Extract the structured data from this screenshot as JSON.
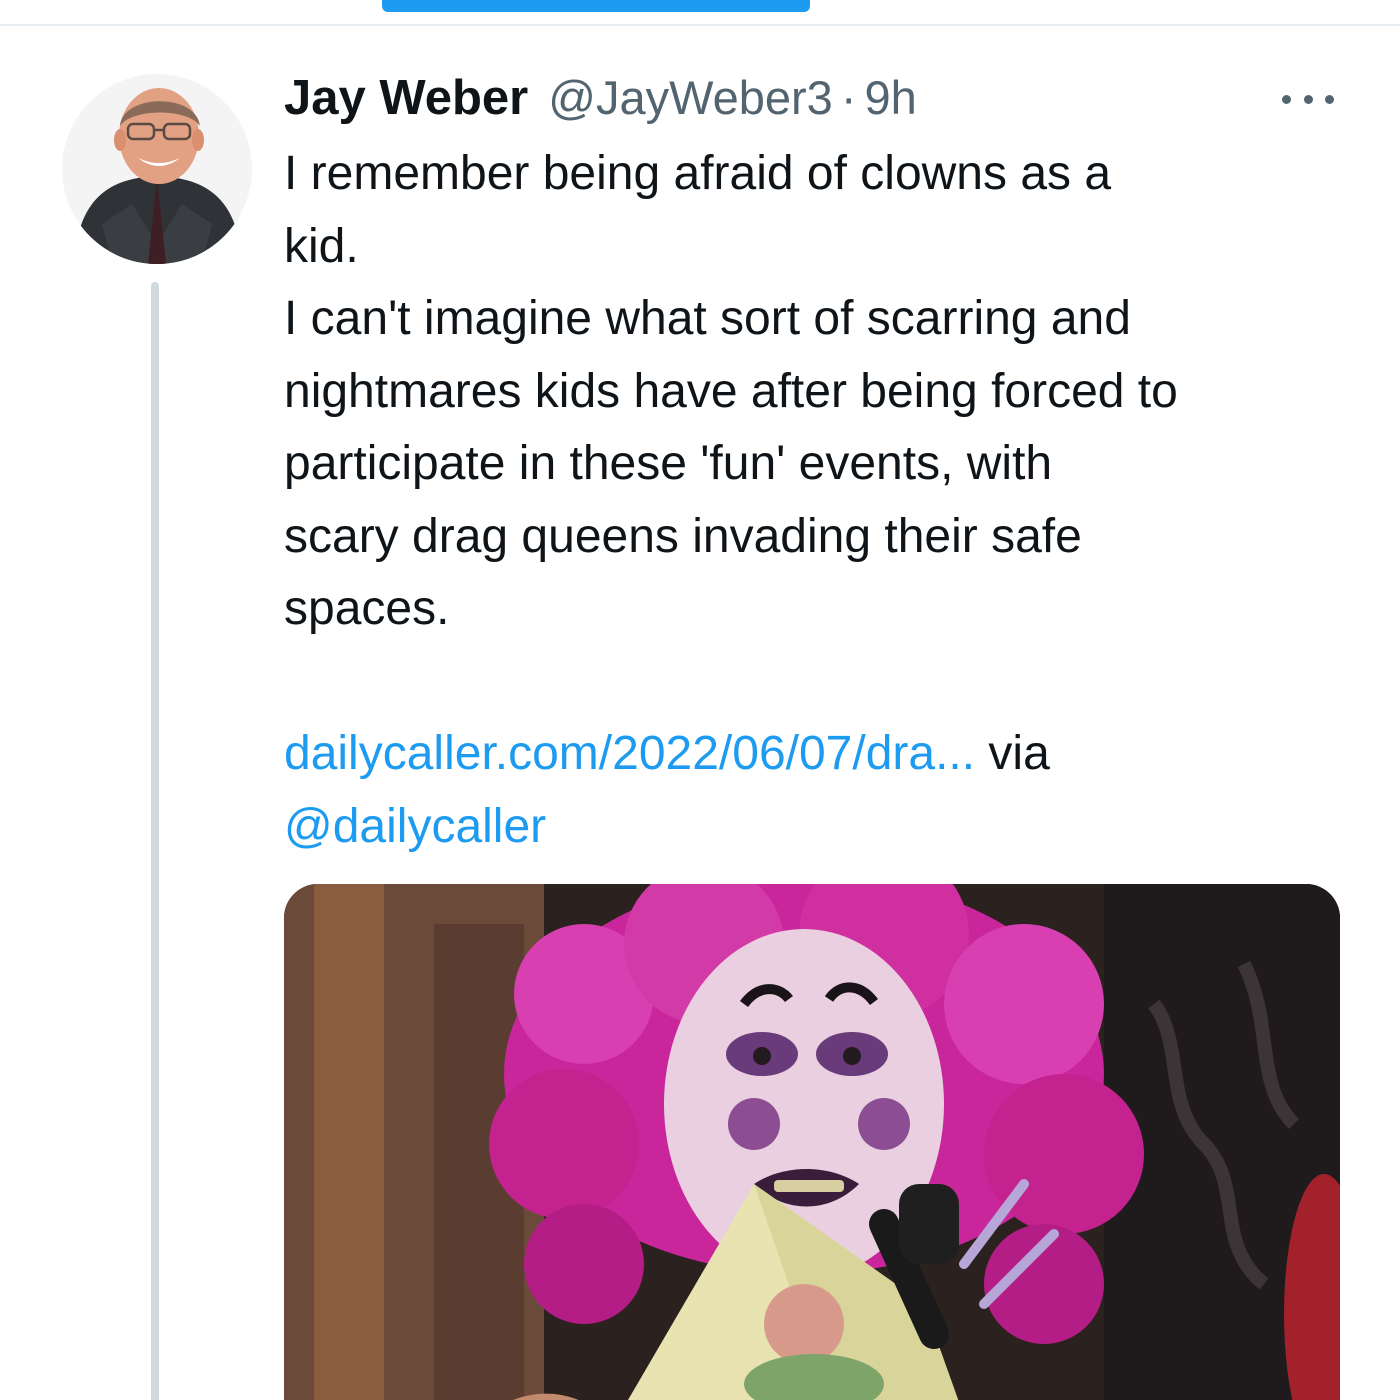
{
  "colors": {
    "accent": "#1d9bf0",
    "text_primary": "#0f1419",
    "text_secondary": "#536471",
    "thread_line": "#cfd9de"
  },
  "tweet": {
    "author_name": "Jay Weber",
    "author_handle": "@JayWeber3",
    "separator": "·",
    "timestamp": "9h",
    "more_icon": "more-horizontal-icon",
    "text_lines": [
      "I remember being afraid of clowns as a",
      "kid.",
      "I can't imagine what sort of scarring and",
      "nightmares kids have after being forced to",
      "participate in these 'fun' events, with",
      "scary drag queens invading their safe",
      "spaces."
    ],
    "link_text": "dailycaller.com/2022/06/07/dra...",
    "via_text": " via",
    "mention": "@dailycaller"
  }
}
